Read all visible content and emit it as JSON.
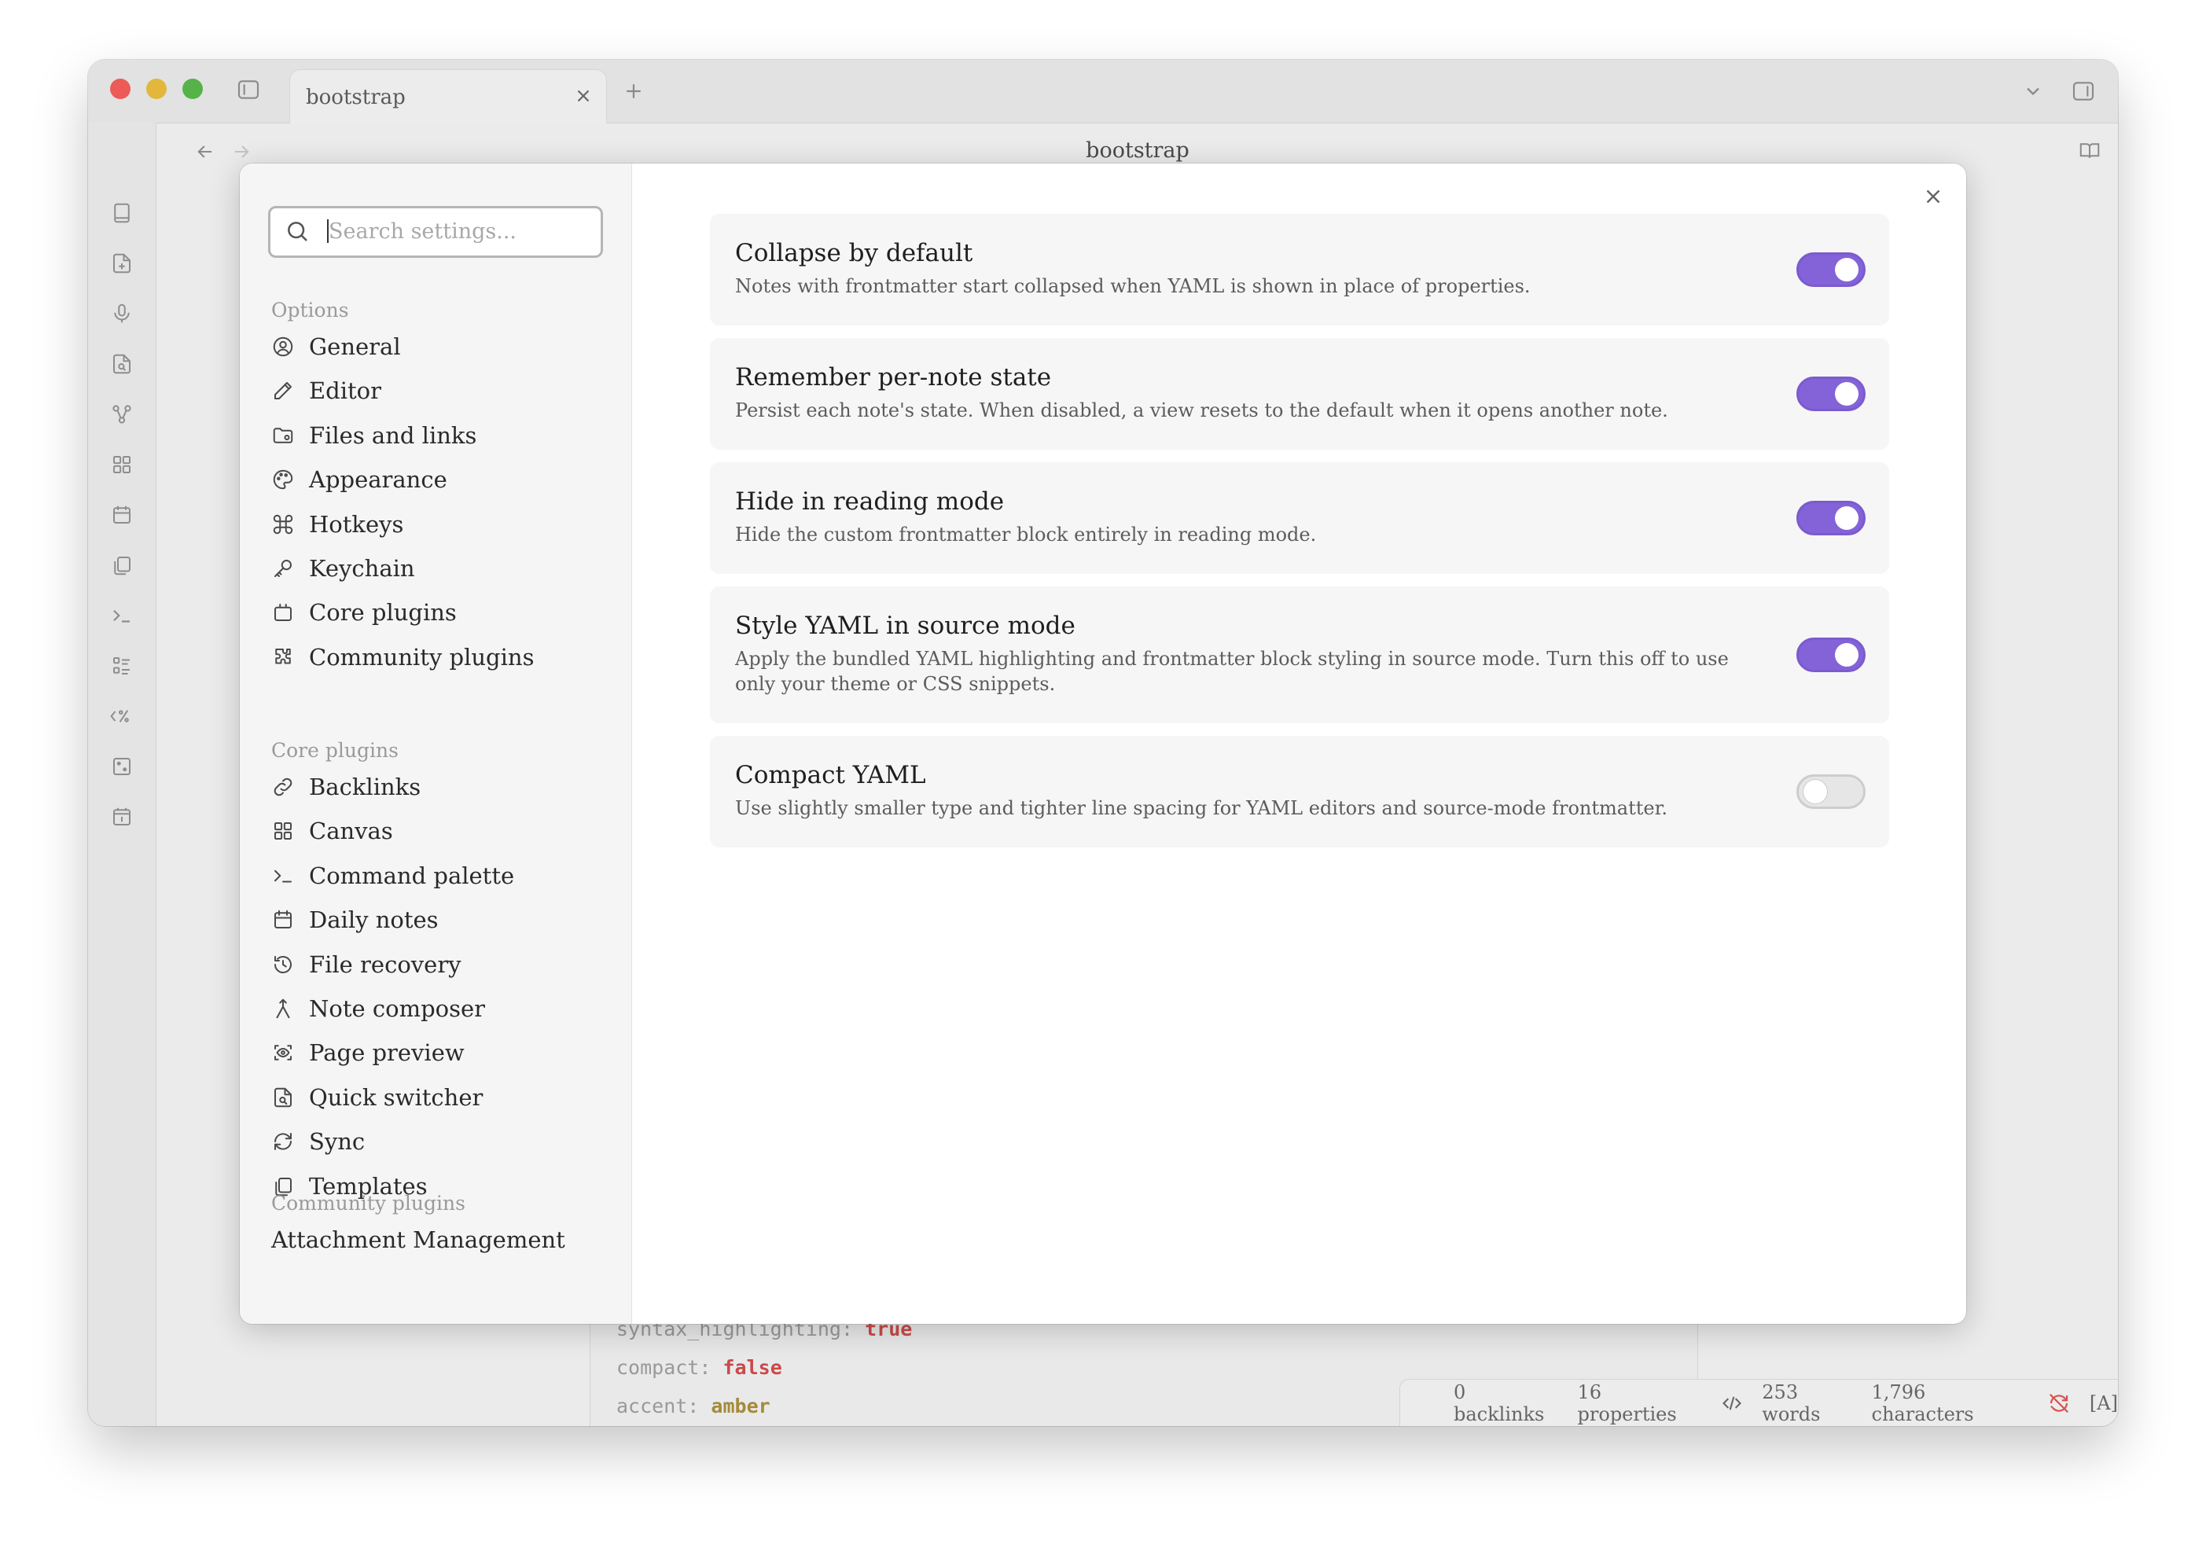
{
  "window": {
    "tab_title": "bootstrap",
    "nav_title": "bootstrap"
  },
  "settings_modal": {
    "search_placeholder": "Search settings...",
    "groups": [
      {
        "label": "Options",
        "items": [
          {
            "label": "General",
            "icon": "user-circle-icon"
          },
          {
            "label": "Editor",
            "icon": "pencil-icon"
          },
          {
            "label": "Files and links",
            "icon": "folder-icon"
          },
          {
            "label": "Appearance",
            "icon": "palette-icon"
          },
          {
            "label": "Hotkeys",
            "icon": "command-icon"
          },
          {
            "label": "Keychain",
            "icon": "key-icon"
          },
          {
            "label": "Core plugins",
            "icon": "plugin-box-icon"
          },
          {
            "label": "Community plugins",
            "icon": "puzzle-icon"
          }
        ]
      },
      {
        "label": "Core plugins",
        "items": [
          {
            "label": "Backlinks",
            "icon": "link-icon"
          },
          {
            "label": "Canvas",
            "icon": "grid-icon"
          },
          {
            "label": "Command palette",
            "icon": "terminal-icon"
          },
          {
            "label": "Daily notes",
            "icon": "calendar-icon"
          },
          {
            "label": "File recovery",
            "icon": "history-icon"
          },
          {
            "label": "Note composer",
            "icon": "merge-icon"
          },
          {
            "label": "Page preview",
            "icon": "eye-scan-icon"
          },
          {
            "label": "Quick switcher",
            "icon": "file-search-icon"
          },
          {
            "label": "Sync",
            "icon": "sync-icon"
          },
          {
            "label": "Templates",
            "icon": "copy-icon"
          }
        ]
      },
      {
        "label": "Community plugins",
        "items": [
          {
            "label": "Attachment Management",
            "icon": ""
          }
        ]
      }
    ],
    "settings": [
      {
        "name": "Collapse by default",
        "desc": "Notes with frontmatter start collapsed when YAML is shown in place of properties.",
        "enabled": true
      },
      {
        "name": "Remember per-note state",
        "desc": "Persist each note's state. When disabled, a view resets to the default when it opens another note.",
        "enabled": true
      },
      {
        "name": "Hide in reading mode",
        "desc": "Hide the custom frontmatter block entirely in reading mode.",
        "enabled": true
      },
      {
        "name": "Style YAML in source mode",
        "desc": "Apply the bundled YAML highlighting and frontmatter block styling in source mode. Turn this off to use only your theme or CSS snippets.",
        "enabled": true
      },
      {
        "name": "Compact YAML",
        "desc": "Use slightly smaller type and tighter line spacing for YAML editors and source-mode frontmatter.",
        "enabled": false
      }
    ],
    "accent_color": "#8463d8"
  },
  "editor": {
    "lines": [
      {
        "key": "syntax_highlighting:",
        "value": "true"
      },
      {
        "key": "compact:",
        "value": "false"
      },
      {
        "key": "accent:",
        "value": "amber"
      }
    ]
  },
  "status_bar": {
    "backlinks": "0 backlinks",
    "properties": "16 properties",
    "words": "253 words",
    "characters": "1,796 characters",
    "mode": "[A]"
  }
}
